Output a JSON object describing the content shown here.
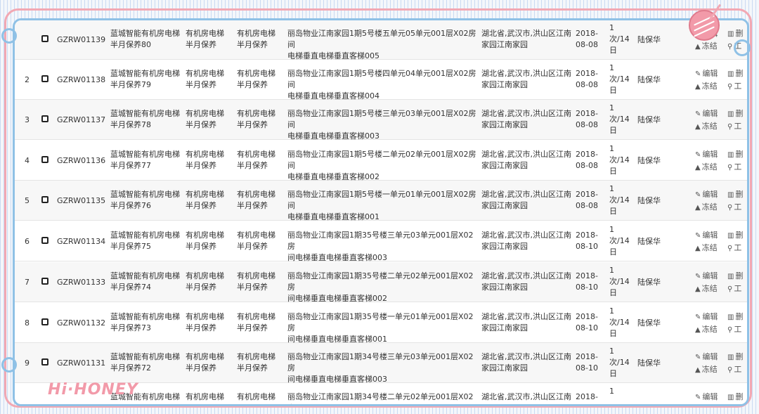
{
  "decoration": {
    "watermark_text": "Hi·HONEY"
  },
  "rows": [
    {
      "idx": "",
      "code": "GZRW01139",
      "name_l1": "蓝城智能有机房电梯",
      "name_l2": "半月保养80",
      "type_l1": "有机房电梯",
      "type_l2": "半月保养",
      "cat_l1": "有机房电梯",
      "cat_l2": "半月保养",
      "loc_l1": "丽岛物业江南家园1期5号楼五单元05单元001层X02房间",
      "loc_l2": "电梯垂直电梯垂直客梯005",
      "area_l1": "湖北省,武汉市,洪山区江南",
      "area_l2": "家园江南家园",
      "date_l1": "2018-",
      "date_l2": "08-08",
      "freq_l1": "1",
      "freq_l2": "次/14",
      "freq_l3": "日",
      "person": "陆保华",
      "edit": "编辑",
      "del": "删",
      "freeze": "冻结",
      "order": "工"
    },
    {
      "idx": "2",
      "code": "GZRW01138",
      "name_l1": "蓝城智能有机房电梯",
      "name_l2": "半月保养79",
      "type_l1": "有机房电梯",
      "type_l2": "半月保养",
      "cat_l1": "有机房电梯",
      "cat_l2": "半月保养",
      "loc_l1": "丽岛物业江南家园1期5号楼四单元04单元001层X02房间",
      "loc_l2": "电梯垂直电梯垂直客梯004",
      "area_l1": "湖北省,武汉市,洪山区江南",
      "area_l2": "家园江南家园",
      "date_l1": "2018-",
      "date_l2": "08-08",
      "freq_l1": "1",
      "freq_l2": "次/14",
      "freq_l3": "日",
      "person": "陆保华",
      "edit": "编辑",
      "del": "删",
      "freeze": "冻结",
      "order": "工"
    },
    {
      "idx": "3",
      "code": "GZRW01137",
      "name_l1": "蓝城智能有机房电梯",
      "name_l2": "半月保养78",
      "type_l1": "有机房电梯",
      "type_l2": "半月保养",
      "cat_l1": "有机房电梯",
      "cat_l2": "半月保养",
      "loc_l1": "丽岛物业江南家园1期5号楼三单元03单元001层X02房间",
      "loc_l2": "电梯垂直电梯垂直客梯003",
      "area_l1": "湖北省,武汉市,洪山区江南",
      "area_l2": "家园江南家园",
      "date_l1": "2018-",
      "date_l2": "08-08",
      "freq_l1": "1",
      "freq_l2": "次/14",
      "freq_l3": "日",
      "person": "陆保华",
      "edit": "编辑",
      "del": "删",
      "freeze": "冻结",
      "order": "工"
    },
    {
      "idx": "4",
      "code": "GZRW01136",
      "name_l1": "蓝城智能有机房电梯",
      "name_l2": "半月保养77",
      "type_l1": "有机房电梯",
      "type_l2": "半月保养",
      "cat_l1": "有机房电梯",
      "cat_l2": "半月保养",
      "loc_l1": "丽岛物业江南家园1期5号楼二单元02单元001层X02房间",
      "loc_l2": "电梯垂直电梯垂直客梯002",
      "area_l1": "湖北省,武汉市,洪山区江南",
      "area_l2": "家园江南家园",
      "date_l1": "2018-",
      "date_l2": "08-08",
      "freq_l1": "1",
      "freq_l2": "次/14",
      "freq_l3": "日",
      "person": "陆保华",
      "edit": "编辑",
      "del": "删",
      "freeze": "冻结",
      "order": "工"
    },
    {
      "idx": "5",
      "code": "GZRW01135",
      "name_l1": "蓝城智能有机房电梯",
      "name_l2": "半月保养76",
      "type_l1": "有机房电梯",
      "type_l2": "半月保养",
      "cat_l1": "有机房电梯",
      "cat_l2": "半月保养",
      "loc_l1": "丽岛物业江南家园1期5号楼一单元01单元001层X02房间",
      "loc_l2": "电梯垂直电梯垂直客梯001",
      "area_l1": "湖北省,武汉市,洪山区江南",
      "area_l2": "家园江南家园",
      "date_l1": "2018-",
      "date_l2": "08-08",
      "freq_l1": "1",
      "freq_l2": "次/14",
      "freq_l3": "日",
      "person": "陆保华",
      "edit": "编辑",
      "del": "删",
      "freeze": "冻结",
      "order": "工"
    },
    {
      "idx": "6",
      "code": "GZRW01134",
      "name_l1": "蓝城智能有机房电梯",
      "name_l2": "半月保养75",
      "type_l1": "有机房电梯",
      "type_l2": "半月保养",
      "cat_l1": "有机房电梯",
      "cat_l2": "半月保养",
      "loc_l1": "丽岛物业江南家园1期35号楼三单元03单元001层X02房",
      "loc_l2": "间电梯垂直电梯垂直客梯003",
      "area_l1": "湖北省,武汉市,洪山区江南",
      "area_l2": "家园江南家园",
      "date_l1": "2018-",
      "date_l2": "08-10",
      "freq_l1": "1",
      "freq_l2": "次/14",
      "freq_l3": "日",
      "person": "陆保华",
      "edit": "编辑",
      "del": "删",
      "freeze": "冻结",
      "order": "工"
    },
    {
      "idx": "7",
      "code": "GZRW01133",
      "name_l1": "蓝城智能有机房电梯",
      "name_l2": "半月保养74",
      "type_l1": "有机房电梯",
      "type_l2": "半月保养",
      "cat_l1": "有机房电梯",
      "cat_l2": "半月保养",
      "loc_l1": "丽岛物业江南家园1期35号楼二单元02单元001层X02房",
      "loc_l2": "间电梯垂直电梯垂直客梯002",
      "area_l1": "湖北省,武汉市,洪山区江南",
      "area_l2": "家园江南家园",
      "date_l1": "2018-",
      "date_l2": "08-10",
      "freq_l1": "1",
      "freq_l2": "次/14",
      "freq_l3": "日",
      "person": "陆保华",
      "edit": "编辑",
      "del": "删",
      "freeze": "冻结",
      "order": "工"
    },
    {
      "idx": "8",
      "code": "GZRW01132",
      "name_l1": "蓝城智能有机房电梯",
      "name_l2": "半月保养73",
      "type_l1": "有机房电梯",
      "type_l2": "半月保养",
      "cat_l1": "有机房电梯",
      "cat_l2": "半月保养",
      "loc_l1": "丽岛物业江南家园1期35号楼一单元01单元001层X02房",
      "loc_l2": "间电梯垂直电梯垂直客梯001",
      "area_l1": "湖北省,武汉市,洪山区江南",
      "area_l2": "家园江南家园",
      "date_l1": "2018-",
      "date_l2": "08-10",
      "freq_l1": "1",
      "freq_l2": "次/14",
      "freq_l3": "日",
      "person": "陆保华",
      "edit": "编辑",
      "del": "删",
      "freeze": "冻结",
      "order": "工"
    },
    {
      "idx": "9",
      "code": "GZRW01131",
      "name_l1": "蓝城智能有机房电梯",
      "name_l2": "半月保养72",
      "type_l1": "有机房电梯",
      "type_l2": "半月保养",
      "cat_l1": "有机房电梯",
      "cat_l2": "半月保养",
      "loc_l1": "丽岛物业江南家园1期34号楼三单元03单元001层X02房",
      "loc_l2": "间电梯垂直电梯垂直客梯003",
      "area_l1": "湖北省,武汉市,洪山区江南",
      "area_l2": "家园江南家园",
      "date_l1": "2018-",
      "date_l2": "08-10",
      "freq_l1": "1",
      "freq_l2": "次/14",
      "freq_l3": "日",
      "person": "陆保华",
      "edit": "编辑",
      "del": "删",
      "freeze": "冻结",
      "order": "工"
    },
    {
      "idx": "",
      "code": "",
      "name_l1": "蓝城智能有机房电梯",
      "name_l2": "",
      "type_l1": "有机房电梯",
      "type_l2": "",
      "cat_l1": "有机房电梯",
      "cat_l2": "",
      "loc_l1": "丽岛物业江南家园1期34号楼二单元02单元001层X02房",
      "loc_l2": "",
      "area_l1": "湖北省,武汉市,洪山区江南",
      "area_l2": "",
      "date_l1": "2018-",
      "date_l2": "",
      "freq_l1": "1",
      "freq_l2": "",
      "freq_l3": "",
      "person": "",
      "edit": "编辑",
      "del": "删",
      "freeze": "",
      "order": ""
    }
  ]
}
